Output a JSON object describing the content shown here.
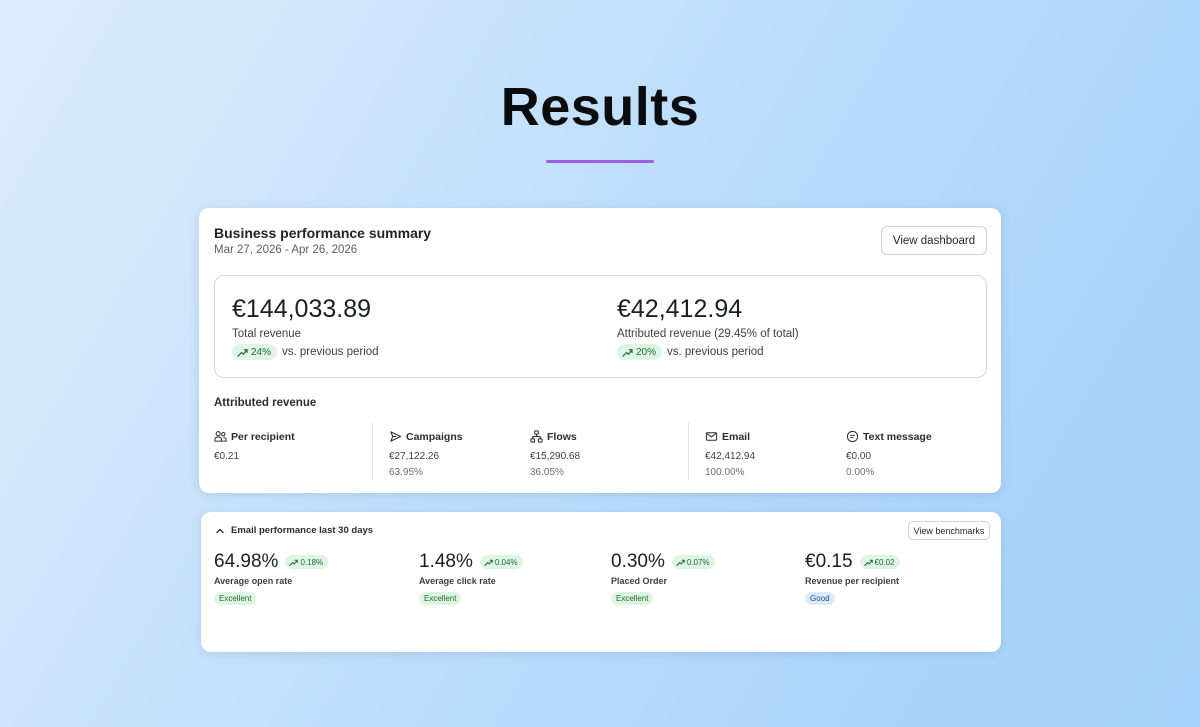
{
  "page": {
    "title": "Results"
  },
  "summary": {
    "title": "Business performance summary",
    "date_range": "Mar 27, 2026 - Apr 26, 2026",
    "view_dashboard_label": "View dashboard",
    "total_revenue": {
      "amount": "€144,033.89",
      "label": "Total revenue",
      "change": "24%",
      "comparison": "vs. previous period"
    },
    "attributed_revenue": {
      "amount": "€42,412.94",
      "label": "Attributed revenue (29.45% of total)",
      "change": "20%",
      "comparison": "vs. previous period"
    },
    "attributed_heading": "Attributed revenue",
    "metrics": [
      {
        "icon": "people-icon",
        "label": "Per recipient",
        "value": "€0.21",
        "pct": ""
      },
      {
        "icon": "send-icon",
        "label": "Campaigns",
        "value": "€27,122.26",
        "pct": "63.95%"
      },
      {
        "icon": "flow-icon",
        "label": "Flows",
        "value": "€15,290.68",
        "pct": "36.05%"
      },
      {
        "icon": "mail-icon",
        "label": "Email",
        "value": "€42,412.94",
        "pct": "100.00%"
      },
      {
        "icon": "message-icon",
        "label": "Text message",
        "value": "€0.00",
        "pct": "0.00%"
      }
    ]
  },
  "email_performance": {
    "title": "Email performance last 30 days",
    "view_benchmarks_label": "View benchmarks",
    "kpis": [
      {
        "value": "64.98%",
        "change": "0.18%",
        "label": "Average open rate",
        "badge": "Excellent"
      },
      {
        "value": "1.48%",
        "change": "0.04%",
        "label": "Average click rate",
        "badge": "Excellent"
      },
      {
        "value": "0.30%",
        "change": "0.07%",
        "label": "Placed Order",
        "badge": "Excellent"
      },
      {
        "value": "€0.15",
        "change": "€0.02",
        "label": "Revenue per recipient",
        "badge": "Good"
      }
    ]
  },
  "colors": {
    "accent_underline": "#9a5fdc",
    "positive_bg": "#dff5e4",
    "positive_text": "#1f6b35",
    "good_bg": "#dbeafb"
  }
}
